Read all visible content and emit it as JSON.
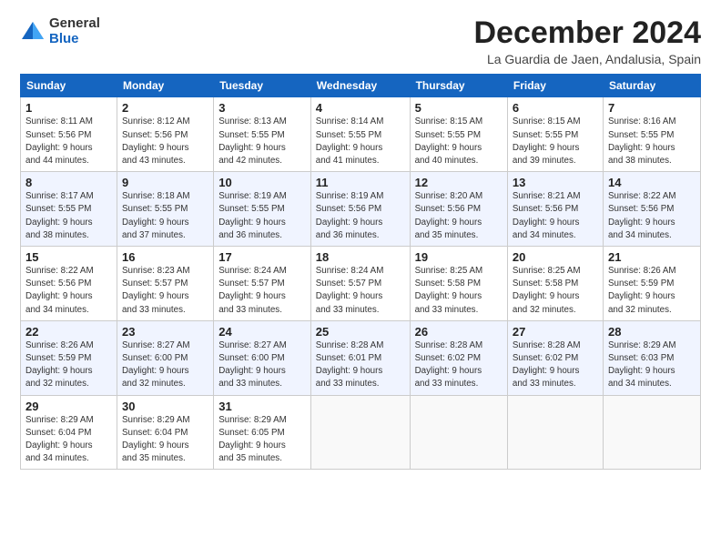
{
  "logo": {
    "general": "General",
    "blue": "Blue"
  },
  "header": {
    "title": "December 2024",
    "subtitle": "La Guardia de Jaen, Andalusia, Spain"
  },
  "weekdays": [
    "Sunday",
    "Monday",
    "Tuesday",
    "Wednesday",
    "Thursday",
    "Friday",
    "Saturday"
  ],
  "weeks": [
    [
      {
        "day": "1",
        "info": "Sunrise: 8:11 AM\nSunset: 5:56 PM\nDaylight: 9 hours\nand 44 minutes."
      },
      {
        "day": "2",
        "info": "Sunrise: 8:12 AM\nSunset: 5:56 PM\nDaylight: 9 hours\nand 43 minutes."
      },
      {
        "day": "3",
        "info": "Sunrise: 8:13 AM\nSunset: 5:55 PM\nDaylight: 9 hours\nand 42 minutes."
      },
      {
        "day": "4",
        "info": "Sunrise: 8:14 AM\nSunset: 5:55 PM\nDaylight: 9 hours\nand 41 minutes."
      },
      {
        "day": "5",
        "info": "Sunrise: 8:15 AM\nSunset: 5:55 PM\nDaylight: 9 hours\nand 40 minutes."
      },
      {
        "day": "6",
        "info": "Sunrise: 8:15 AM\nSunset: 5:55 PM\nDaylight: 9 hours\nand 39 minutes."
      },
      {
        "day": "7",
        "info": "Sunrise: 8:16 AM\nSunset: 5:55 PM\nDaylight: 9 hours\nand 38 minutes."
      }
    ],
    [
      {
        "day": "8",
        "info": "Sunrise: 8:17 AM\nSunset: 5:55 PM\nDaylight: 9 hours\nand 38 minutes."
      },
      {
        "day": "9",
        "info": "Sunrise: 8:18 AM\nSunset: 5:55 PM\nDaylight: 9 hours\nand 37 minutes."
      },
      {
        "day": "10",
        "info": "Sunrise: 8:19 AM\nSunset: 5:55 PM\nDaylight: 9 hours\nand 36 minutes."
      },
      {
        "day": "11",
        "info": "Sunrise: 8:19 AM\nSunset: 5:56 PM\nDaylight: 9 hours\nand 36 minutes."
      },
      {
        "day": "12",
        "info": "Sunrise: 8:20 AM\nSunset: 5:56 PM\nDaylight: 9 hours\nand 35 minutes."
      },
      {
        "day": "13",
        "info": "Sunrise: 8:21 AM\nSunset: 5:56 PM\nDaylight: 9 hours\nand 34 minutes."
      },
      {
        "day": "14",
        "info": "Sunrise: 8:22 AM\nSunset: 5:56 PM\nDaylight: 9 hours\nand 34 minutes."
      }
    ],
    [
      {
        "day": "15",
        "info": "Sunrise: 8:22 AM\nSunset: 5:56 PM\nDaylight: 9 hours\nand 34 minutes."
      },
      {
        "day": "16",
        "info": "Sunrise: 8:23 AM\nSunset: 5:57 PM\nDaylight: 9 hours\nand 33 minutes."
      },
      {
        "day": "17",
        "info": "Sunrise: 8:24 AM\nSunset: 5:57 PM\nDaylight: 9 hours\nand 33 minutes."
      },
      {
        "day": "18",
        "info": "Sunrise: 8:24 AM\nSunset: 5:57 PM\nDaylight: 9 hours\nand 33 minutes."
      },
      {
        "day": "19",
        "info": "Sunrise: 8:25 AM\nSunset: 5:58 PM\nDaylight: 9 hours\nand 33 minutes."
      },
      {
        "day": "20",
        "info": "Sunrise: 8:25 AM\nSunset: 5:58 PM\nDaylight: 9 hours\nand 32 minutes."
      },
      {
        "day": "21",
        "info": "Sunrise: 8:26 AM\nSunset: 5:59 PM\nDaylight: 9 hours\nand 32 minutes."
      }
    ],
    [
      {
        "day": "22",
        "info": "Sunrise: 8:26 AM\nSunset: 5:59 PM\nDaylight: 9 hours\nand 32 minutes."
      },
      {
        "day": "23",
        "info": "Sunrise: 8:27 AM\nSunset: 6:00 PM\nDaylight: 9 hours\nand 32 minutes."
      },
      {
        "day": "24",
        "info": "Sunrise: 8:27 AM\nSunset: 6:00 PM\nDaylight: 9 hours\nand 33 minutes."
      },
      {
        "day": "25",
        "info": "Sunrise: 8:28 AM\nSunset: 6:01 PM\nDaylight: 9 hours\nand 33 minutes."
      },
      {
        "day": "26",
        "info": "Sunrise: 8:28 AM\nSunset: 6:02 PM\nDaylight: 9 hours\nand 33 minutes."
      },
      {
        "day": "27",
        "info": "Sunrise: 8:28 AM\nSunset: 6:02 PM\nDaylight: 9 hours\nand 33 minutes."
      },
      {
        "day": "28",
        "info": "Sunrise: 8:29 AM\nSunset: 6:03 PM\nDaylight: 9 hours\nand 34 minutes."
      }
    ],
    [
      {
        "day": "29",
        "info": "Sunrise: 8:29 AM\nSunset: 6:04 PM\nDaylight: 9 hours\nand 34 minutes."
      },
      {
        "day": "30",
        "info": "Sunrise: 8:29 AM\nSunset: 6:04 PM\nDaylight: 9 hours\nand 35 minutes."
      },
      {
        "day": "31",
        "info": "Sunrise: 8:29 AM\nSunset: 6:05 PM\nDaylight: 9 hours\nand 35 minutes."
      },
      null,
      null,
      null,
      null
    ]
  ]
}
